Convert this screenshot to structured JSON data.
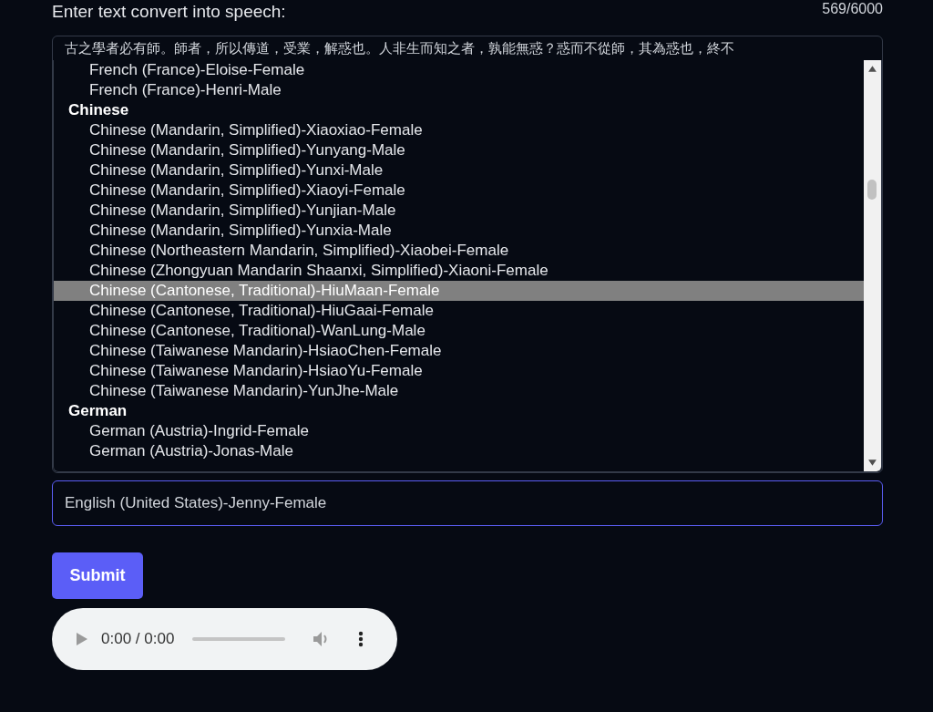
{
  "heading": "Enter text convert into speech:",
  "counter": "569/6000",
  "text": "古之學者必有師。師者，所以傳道，受業，解惑也。人非生而知之者，孰能無惑？惑而不從師，其為惑也，終不",
  "voice_list": [
    {
      "options": [
        {
          "label": "French (France)-Eloise-Female",
          "selected": false
        },
        {
          "label": "French (France)-Henri-Male",
          "selected": false
        }
      ]
    },
    {
      "group": "Chinese",
      "options": [
        {
          "label": "Chinese (Mandarin, Simplified)-Xiaoxiao-Female",
          "selected": false
        },
        {
          "label": "Chinese (Mandarin, Simplified)-Yunyang-Male",
          "selected": false
        },
        {
          "label": "Chinese (Mandarin, Simplified)-Yunxi-Male",
          "selected": false
        },
        {
          "label": "Chinese (Mandarin, Simplified)-Xiaoyi-Female",
          "selected": false
        },
        {
          "label": "Chinese (Mandarin, Simplified)-Yunjian-Male",
          "selected": false
        },
        {
          "label": "Chinese (Mandarin, Simplified)-Yunxia-Male",
          "selected": false
        },
        {
          "label": "Chinese (Northeastern Mandarin, Simplified)-Xiaobei-Female",
          "selected": false
        },
        {
          "label": "Chinese (Zhongyuan Mandarin Shaanxi, Simplified)-Xiaoni-Female",
          "selected": false
        },
        {
          "label": "Chinese (Cantonese, Traditional)-HiuMaan-Female",
          "selected": true
        },
        {
          "label": "Chinese (Cantonese, Traditional)-HiuGaai-Female",
          "selected": false
        },
        {
          "label": "Chinese (Cantonese, Traditional)-WanLung-Male",
          "selected": false
        },
        {
          "label": "Chinese (Taiwanese Mandarin)-HsiaoChen-Female",
          "selected": false
        },
        {
          "label": "Chinese (Taiwanese Mandarin)-HsiaoYu-Female",
          "selected": false
        },
        {
          "label": "Chinese (Taiwanese Mandarin)-YunJhe-Male",
          "selected": false
        }
      ]
    },
    {
      "group": "German",
      "options": [
        {
          "label": "German (Austria)-Ingrid-Female",
          "selected": false
        },
        {
          "label": "German (Austria)-Jonas-Male",
          "selected": false
        }
      ]
    }
  ],
  "voice_field": {
    "value": "English (United States)-Jenny-Female"
  },
  "submit": "Submit",
  "audio": {
    "time": "0:00 / 0:00"
  }
}
